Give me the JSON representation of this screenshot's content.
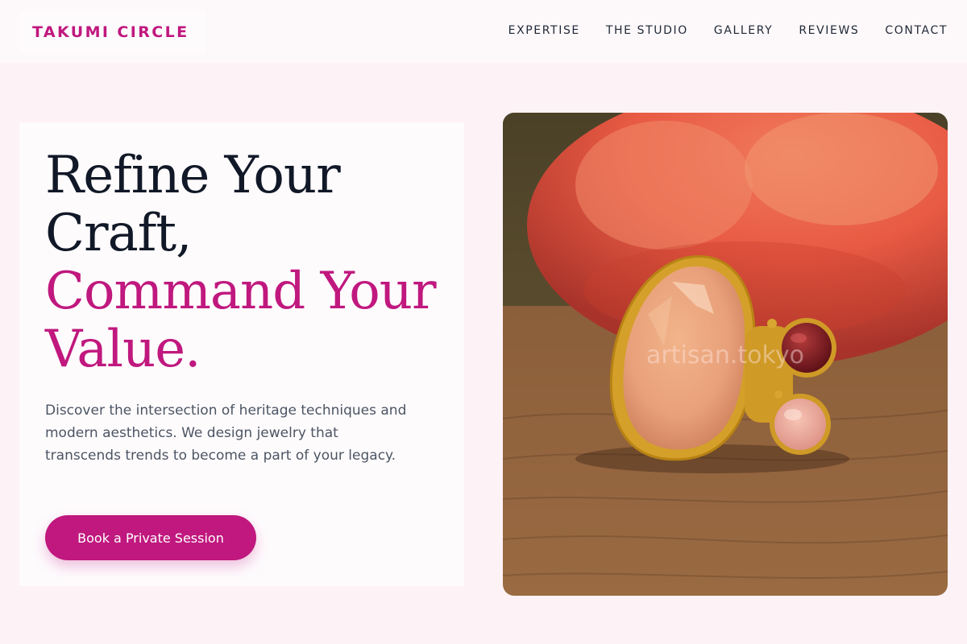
{
  "header": {
    "brand": "TAKUMI CIRCLE",
    "nav": [
      {
        "label": "EXPERTISE"
      },
      {
        "label": "THE STUDIO"
      },
      {
        "label": "GALLERY"
      },
      {
        "label": "REVIEWS"
      },
      {
        "label": "CONTACT"
      }
    ]
  },
  "hero": {
    "headline_line1": "Refine Your",
    "headline_line2": "Craft,",
    "headline_accent_line1": "Command Your",
    "headline_accent_line2": "Value.",
    "description": "Discover the intersection of heritage techniques and modern aesthetics. We design jewelry that transcends trends to become a part of your legacy.",
    "cta_label": "Book a Private Session"
  },
  "image": {
    "subject": "gemstone ring on wooden surface with orange rose",
    "watermark": "artisan.tokyo"
  },
  "colors": {
    "accent": "#c0187e",
    "page_background": "#fdf2f6",
    "headline_dark": "#111827",
    "body_text": "#4b5563"
  }
}
